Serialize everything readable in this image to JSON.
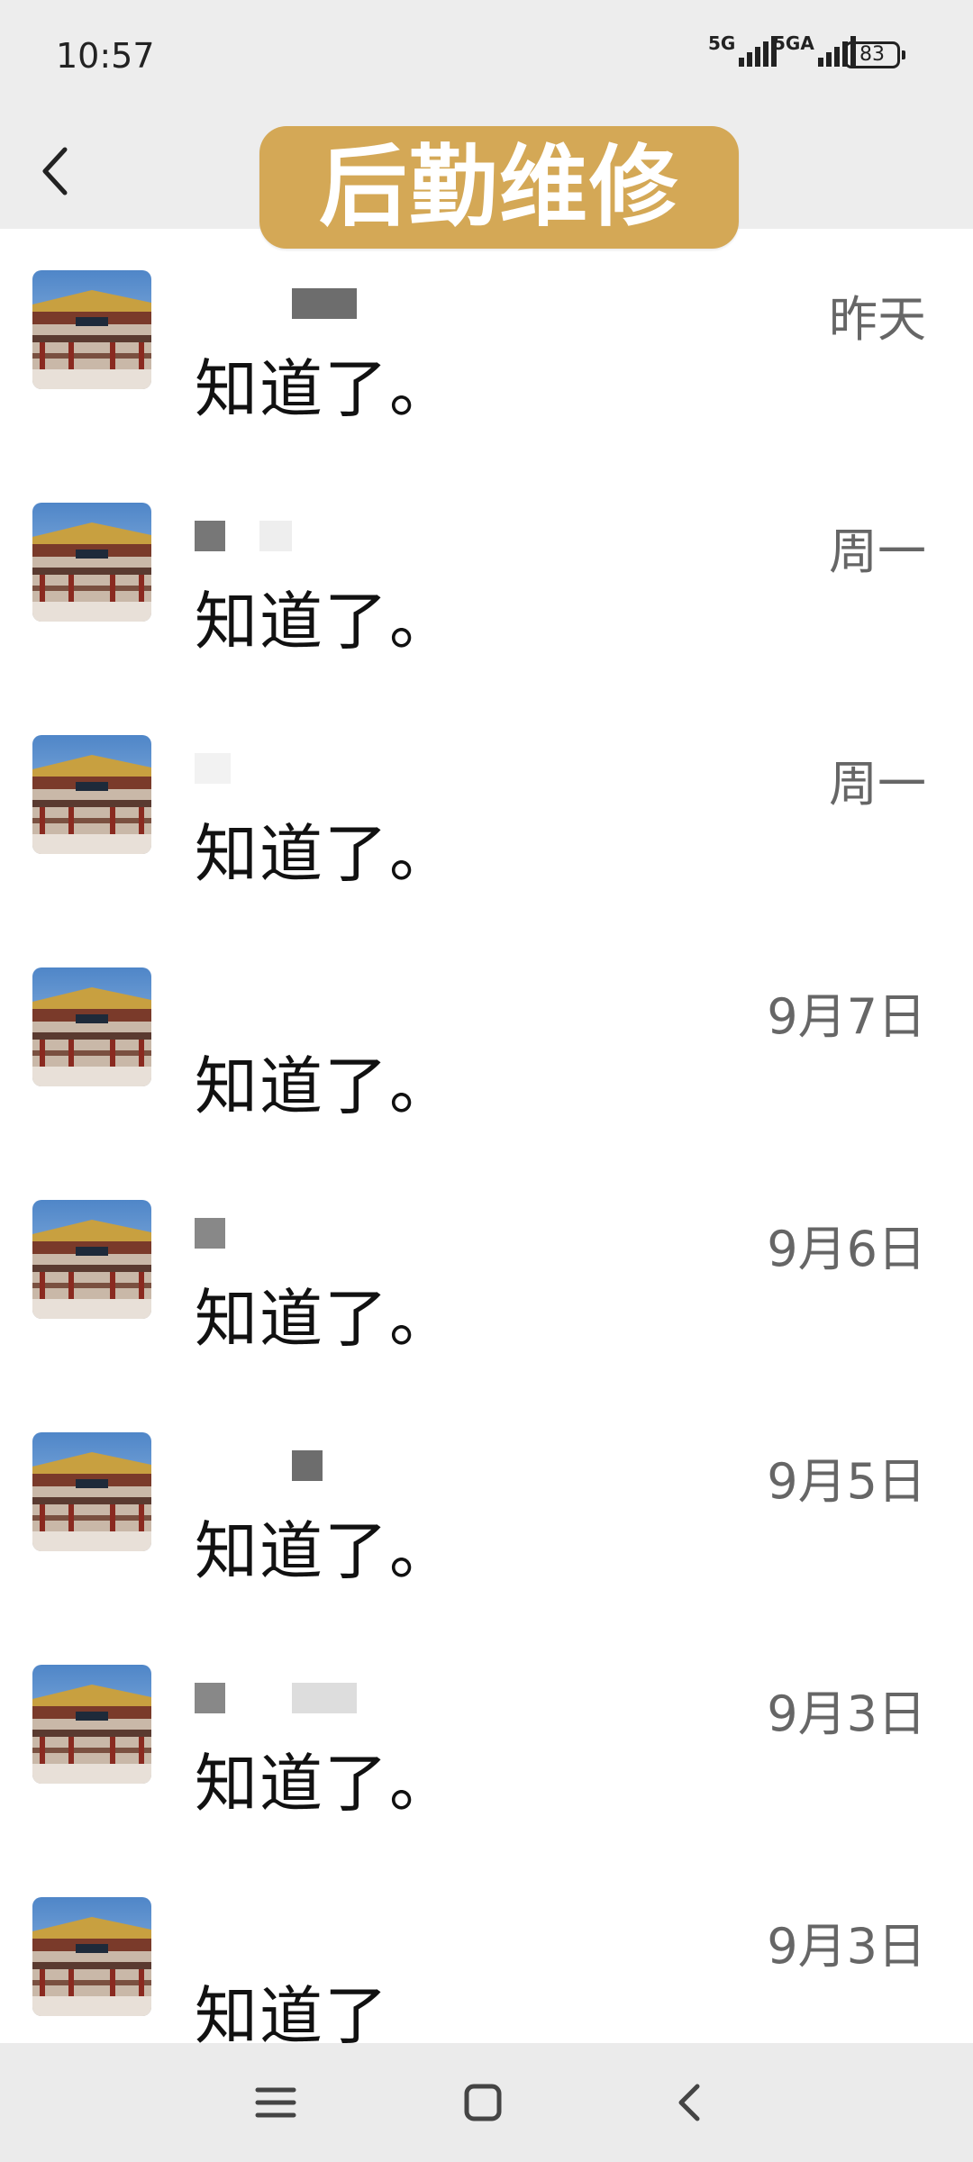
{
  "status_bar": {
    "time": "10:57",
    "signal1_label": "5G",
    "signal2_label": "5GA",
    "battery": "83"
  },
  "header": {
    "title": "后勤维修",
    "title_bg": "#d4a856"
  },
  "conversations": [
    {
      "message": "知道了。",
      "date": "昨天"
    },
    {
      "message": "知道了。",
      "date": "周一"
    },
    {
      "message": "知道了。",
      "date": "周一"
    },
    {
      "message": "知道了。",
      "date": "9月7日"
    },
    {
      "message": "知道了。",
      "date": "9月6日"
    },
    {
      "message": "知道了。",
      "date": "9月5日"
    },
    {
      "message": "知道了。",
      "date": "9月3日"
    },
    {
      "message": "知道了",
      "date": "9月3日"
    }
  ],
  "nav_bar": {
    "icons": [
      "menu-icon",
      "home-square-icon",
      "back-chevron-icon"
    ]
  }
}
